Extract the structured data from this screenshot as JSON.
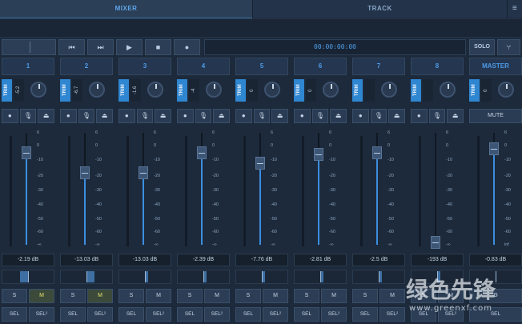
{
  "tabs": {
    "mixer": "MIXER",
    "track": "TRACK",
    "menu_icon": "hamburger-menu-icon"
  },
  "transport": {
    "prev_icon": "skip-back-icon",
    "next_icon": "skip-forward-icon",
    "play_icon": "play-icon",
    "stop_icon": "stop-icon",
    "record_icon": "record-icon",
    "time": "00:00:00:00",
    "solo": "SOLO",
    "settings_icon": "tuning-fork-icon"
  },
  "channels": [
    {
      "name": "1",
      "trim_label": "TRIM",
      "trim": "-5.2",
      "db": "-2.19 dB",
      "fader": 0.82,
      "pan": -0.1,
      "s": "S",
      "m": "M",
      "m_on": true,
      "sel": "SEL",
      "sel2": "SEL²"
    },
    {
      "name": "2",
      "trim_label": "TRIM",
      "trim": "-6.7",
      "db": "-13.03 dB",
      "fader": 0.64,
      "pan": 0.1,
      "s": "S",
      "m": "M",
      "m_on": true,
      "sel": "SEL",
      "sel2": "SEL²"
    },
    {
      "name": "3",
      "trim_label": "TRIM",
      "trim": "-1.6",
      "db": "-13.03 dB",
      "fader": 0.64,
      "pan": 0.0,
      "s": "S",
      "m": "M",
      "m_on": false,
      "sel": "SEL",
      "sel2": "SEL²"
    },
    {
      "name": "4",
      "trim_label": "TRIM",
      "trim": "-4",
      "db": "-2.39 dB",
      "fader": 0.82,
      "pan": 0.0,
      "s": "S",
      "m": "M",
      "m_on": false,
      "sel": "SEL",
      "sel2": "SEL²"
    },
    {
      "name": "5",
      "trim_label": "TRIM",
      "trim": "0",
      "db": "-7.76 dB",
      "fader": 0.73,
      "pan": 0.0,
      "s": "S",
      "m": "M",
      "m_on": false,
      "sel": "SEL",
      "sel2": "SEL²"
    },
    {
      "name": "6",
      "trim_label": "TRIM",
      "trim": "0",
      "db": "-2.81 dB",
      "fader": 0.81,
      "pan": 0.0,
      "s": "S",
      "m": "M",
      "m_on": false,
      "sel": "SEL",
      "sel2": "SEL²"
    },
    {
      "name": "7",
      "trim_label": "TRIM",
      "trim": "",
      "db": "-2.5 dB",
      "fader": 0.82,
      "pan": 0.0,
      "s": "S",
      "m": "M",
      "m_on": false,
      "sel": "SEL",
      "sel2": "SEL²"
    },
    {
      "name": "8",
      "trim_label": "TRIM",
      "trim": "",
      "db": "-193 dB",
      "fader": 0.02,
      "pan": 0.0,
      "s": "S",
      "m": "M",
      "m_on": false,
      "sel": "SEL",
      "sel2": "SEL²"
    }
  ],
  "master": {
    "name": "MASTER",
    "trim_label": "TRIM",
    "trim": "0",
    "mute": "MUTE",
    "db": "-0.83 dB",
    "fader": 0.86,
    "sel": "SEL"
  },
  "scale": [
    "6",
    "0",
    "-10",
    "-20",
    "-30",
    "-40",
    "-50",
    "-60",
    "-∞"
  ],
  "master_scale_last": "inf",
  "input_icons": [
    "phase-icon",
    "mic-icon",
    "hat-icon"
  ],
  "watermark": {
    "cn": "绿色先锋",
    "url": "www.greenxf.com"
  },
  "colors": {
    "accent": "#3b8ee0",
    "mute_on": "#e9e06a"
  }
}
